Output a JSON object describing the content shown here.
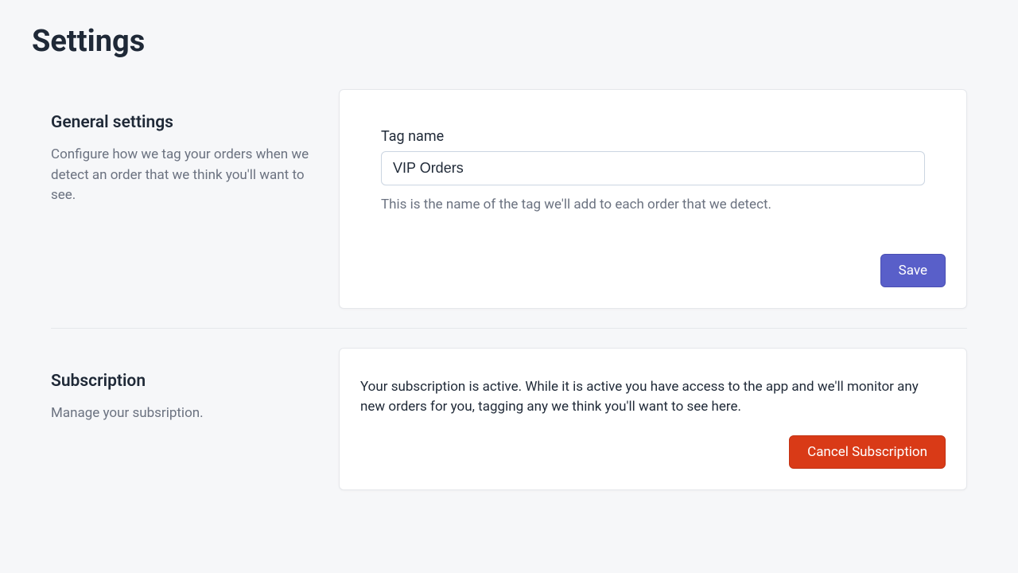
{
  "page": {
    "title": "Settings"
  },
  "general": {
    "heading": "General settings",
    "description": "Configure how we tag your orders when we detect an order that we think you'll want to see.",
    "tag_label": "Tag name",
    "tag_value": "VIP Orders",
    "tag_help": "This is the name of the tag we'll add to each order that we detect.",
    "save_label": "Save"
  },
  "subscription": {
    "heading": "Subscription",
    "description": "Manage your subsription.",
    "status_text": "Your subscription is active. While it is active you have access to the app and we'll monitor any new orders for you, tagging any we think you'll want to see here.",
    "cancel_label": "Cancel Subscription"
  }
}
